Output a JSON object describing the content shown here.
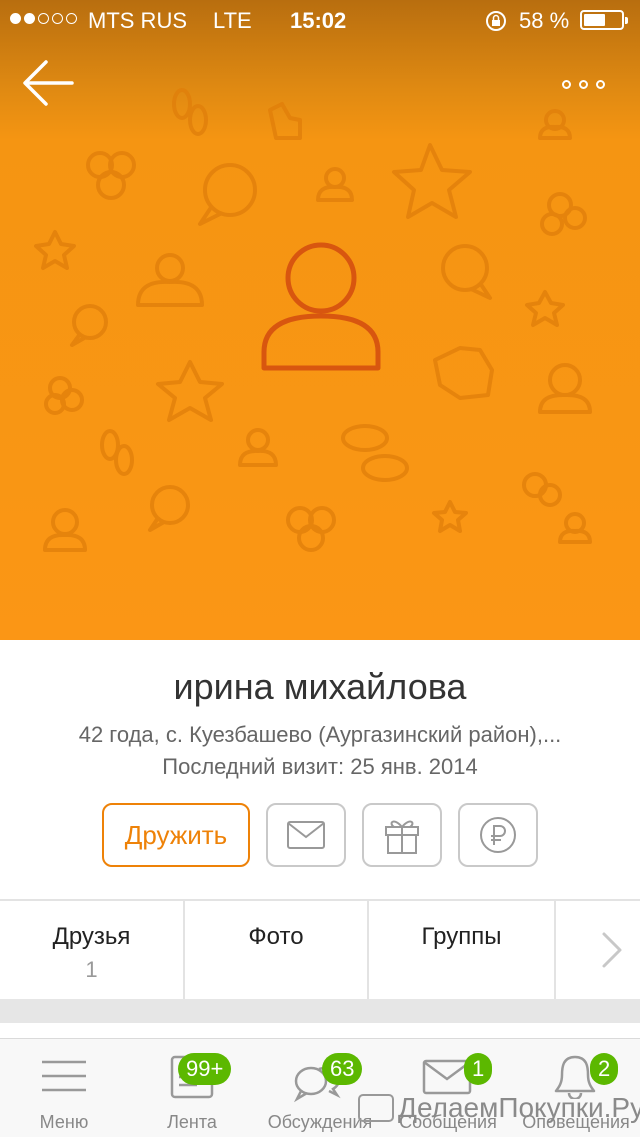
{
  "status_bar": {
    "signal_dots_filled": 2,
    "signal_dots_total": 5,
    "carrier": "MTS RUS",
    "network": "LTE",
    "time": "15:02",
    "battery_percent": "58 %",
    "battery_level": 0.58,
    "icons": [
      "rotation-lock-icon",
      "battery-icon"
    ]
  },
  "header": {
    "back_icon": "back-arrow-icon",
    "more_icon": "more-dots-icon"
  },
  "profile": {
    "name": "ирина михайлова",
    "info_line": "42 года, с. Куезбашево (Аургазинский район),...",
    "last_visit": "Последний визит: 25 янв. 2014",
    "avatar_icon": "user-placeholder-icon"
  },
  "actions": {
    "befriend_label": "Дружить",
    "message_icon": "envelope-icon",
    "gift_icon": "gift-icon",
    "payment_icon": "ruble-icon"
  },
  "tabs": [
    {
      "label": "Друзья",
      "count": "1"
    },
    {
      "label": "Фото",
      "count": ""
    },
    {
      "label": "Группы",
      "count": ""
    }
  ],
  "nav": [
    {
      "label": "Меню",
      "icon": "menu-icon",
      "badge": ""
    },
    {
      "label": "Лента",
      "icon": "feed-icon",
      "badge": "99+"
    },
    {
      "label": "Обсуждения",
      "icon": "discussions-icon",
      "badge": "63"
    },
    {
      "label": "Сообщения",
      "icon": "messages-icon",
      "badge": "1"
    },
    {
      "label": "Оповещения",
      "icon": "bell-icon",
      "badge": "2"
    }
  ],
  "watermark": "ДелаемПокупки.Ру",
  "colors": {
    "accent": "#ee8208",
    "cover": "#fb9615",
    "badge": "#5cb800"
  }
}
